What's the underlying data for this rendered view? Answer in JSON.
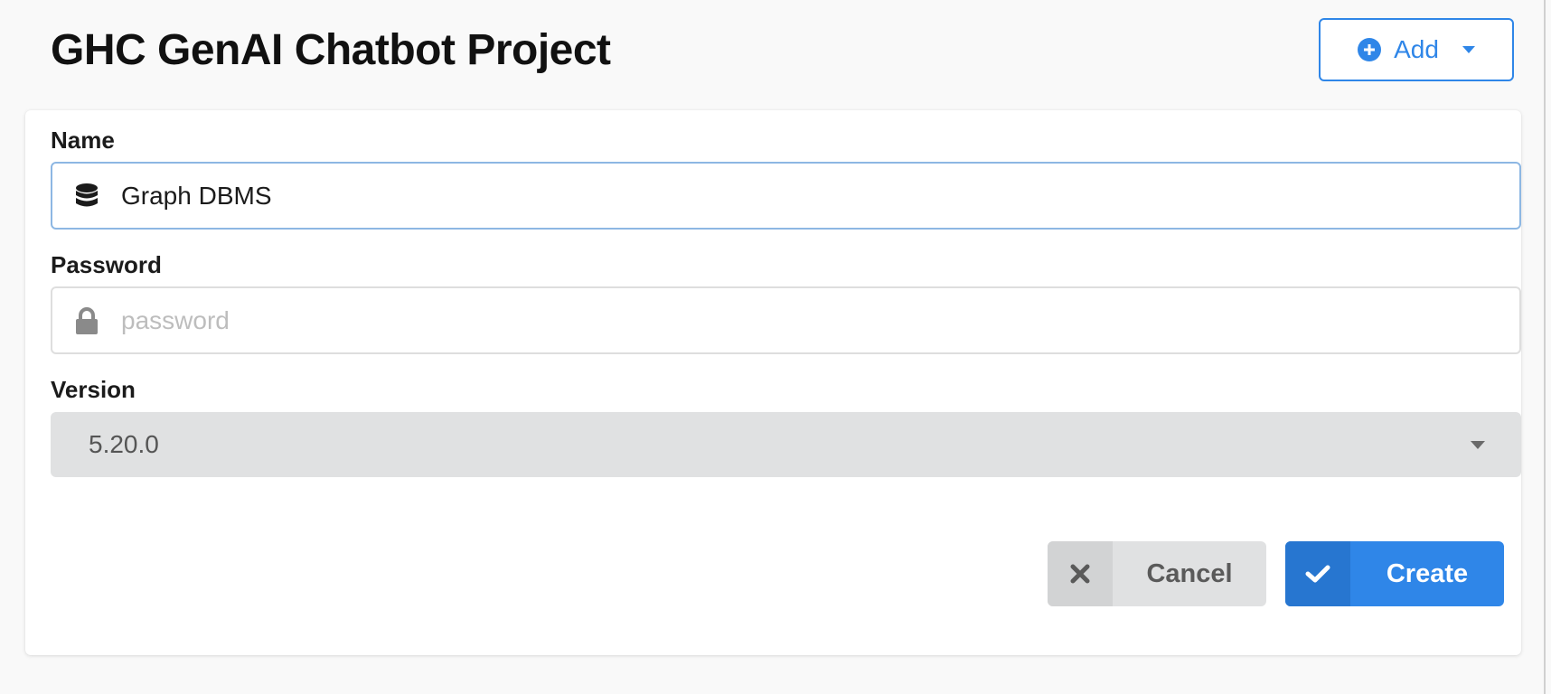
{
  "header": {
    "title": "GHC GenAI Chatbot Project",
    "add_button": {
      "label": "Add",
      "icon": "plus-circle-icon",
      "accent": "#2f86e8"
    }
  },
  "form": {
    "name": {
      "label": "Name",
      "value": "Graph DBMS",
      "icon": "database-icon"
    },
    "password": {
      "label": "Password",
      "value": "",
      "placeholder": "password",
      "icon": "lock-icon"
    },
    "version": {
      "label": "Version",
      "selected": "5.20.0"
    },
    "buttons": {
      "cancel": {
        "label": "Cancel",
        "icon": "close-icon"
      },
      "create": {
        "label": "Create",
        "icon": "check-icon",
        "color": "#2f86e8"
      }
    }
  }
}
